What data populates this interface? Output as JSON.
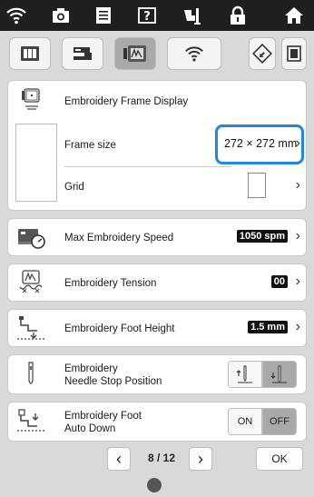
{
  "top_icons": [
    "wifi-icon",
    "camera-icon",
    "document-icon",
    "help-icon",
    "thread-icon",
    "lock-icon",
    "home-icon"
  ],
  "tabs": [
    {
      "icon": "machine-settings-icon"
    },
    {
      "icon": "sewing-machine-icon"
    },
    {
      "icon": "embroidery-settings-icon"
    },
    {
      "icon": "wifi-icon"
    },
    {
      "icon": "reset-icon"
    },
    {
      "icon": "save-icon"
    }
  ],
  "frame_display": {
    "title": "Embroidery Frame Display",
    "frame_size_label": "Frame size",
    "frame_size_value": "272 × 272 mm",
    "grid_label": "Grid"
  },
  "max_speed": {
    "label": "Max Embroidery Speed",
    "value": "1050 spm"
  },
  "tension": {
    "label": "Embroidery Tension",
    "value": "00"
  },
  "foot_height": {
    "label": "Embroidery Foot Height",
    "value": "1.5 mm"
  },
  "needle_stop": {
    "label_line1": "Embroidery",
    "label_line2": "Needle Stop Position"
  },
  "foot_auto_down": {
    "label_line1": "Embroidery Foot",
    "label_line2": "Auto Down",
    "on_label": "ON",
    "off_label": "OFF",
    "selected": "OFF"
  },
  "pager": {
    "page_text": "8 / 12",
    "ok_label": "OK"
  },
  "colors": {
    "highlight": "#1e88e5",
    "selected": "#a9a9a9"
  }
}
